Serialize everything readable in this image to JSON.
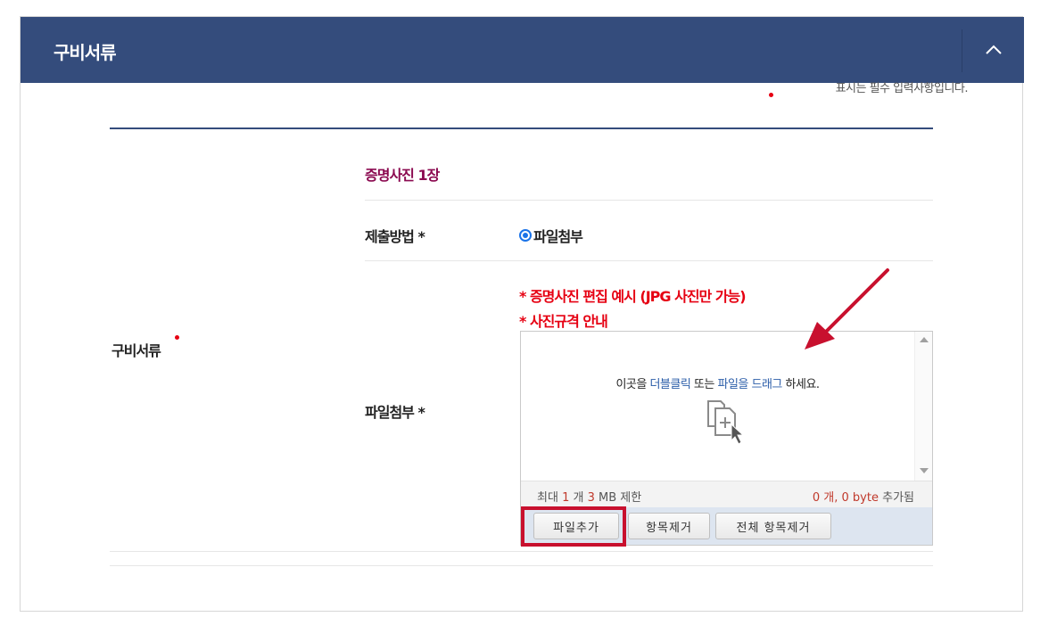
{
  "header": {
    "title": "구비서류"
  },
  "required_note": "표시는 필수 입력사항입니다.",
  "group_label": "구비서류",
  "section_title": "증명사진 1장",
  "submit_method": {
    "label": "제출방법 *",
    "option_label": "파일첨부"
  },
  "attachment": {
    "label": "파일첨부 *",
    "notice_1": "* 증명사진 편집 예시 (JPG 사진만 가능)",
    "notice_2": "* 사진규격 안내",
    "drop_hint": {
      "prefix": "이곳을 ",
      "link1": "더블클릭",
      "middle": " 또는 ",
      "link2": "파일을 드래그",
      "suffix": " 하세요."
    },
    "limit": {
      "prefix": "최대 ",
      "count": "1",
      "count_unit": " 개 ",
      "size": "3",
      "size_unit": " MB 제한"
    },
    "usage": {
      "count": "0",
      "count_unit": " 개, ",
      "bytes": "0",
      "bytes_unit": " byte",
      "suffix": " 추가됨"
    },
    "buttons": {
      "add": "파일추가",
      "remove": "항목제거",
      "clear": "전체 항목제거"
    }
  },
  "colors": {
    "header_bg": "#344c7c",
    "required_red": "#e60012",
    "section_title": "#8b0a50",
    "highlight": "#c8102e"
  },
  "icons": [
    "chevron-up-icon",
    "add-file-icon",
    "arrow-annotation"
  ]
}
